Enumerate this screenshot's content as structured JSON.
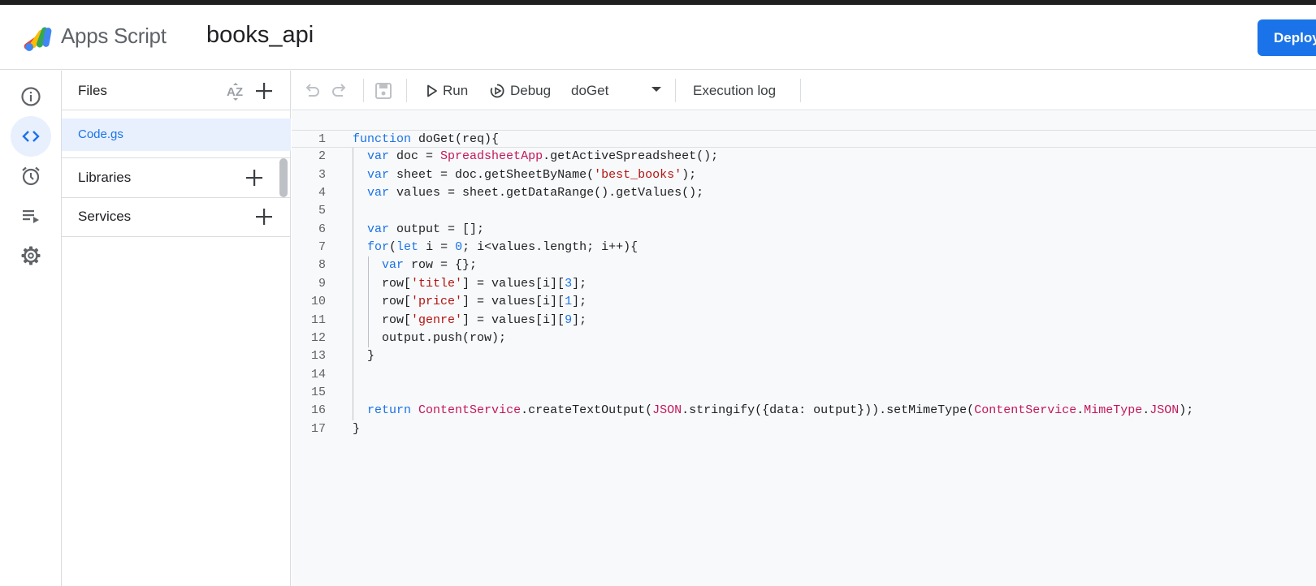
{
  "header": {
    "app_name": "Apps Script",
    "project_title": "books_api",
    "deploy_label": "Deploy"
  },
  "nav_rail": {
    "items": [
      {
        "name": "overview",
        "icon": "info-icon"
      },
      {
        "name": "editor",
        "icon": "code-icon",
        "active": true
      },
      {
        "name": "triggers",
        "icon": "alarm-icon"
      },
      {
        "name": "executions",
        "icon": "list-play-icon"
      },
      {
        "name": "settings",
        "icon": "gear-icon"
      }
    ]
  },
  "files_panel": {
    "files_label": "Files",
    "files": [
      "Code.gs"
    ],
    "libraries_label": "Libraries",
    "services_label": "Services"
  },
  "toolbar": {
    "run_label": "Run",
    "debug_label": "Debug",
    "function_selected": "doGet",
    "execution_log_label": "Execution log"
  },
  "editor": {
    "line_numbers": [
      "1",
      "2",
      "3",
      "4",
      "5",
      "6",
      "7",
      "8",
      "9",
      "10",
      "11",
      "12",
      "13",
      "14",
      "15",
      "16",
      "17"
    ],
    "lines": [
      {
        "tokens": [
          {
            "t": "function",
            "c": "kw"
          },
          {
            "t": " doGet(req){",
            "c": ""
          }
        ]
      },
      {
        "tokens": [
          {
            "t": "  ",
            "c": ""
          },
          {
            "t": "var",
            "c": "kw"
          },
          {
            "t": " doc = ",
            "c": ""
          },
          {
            "t": "SpreadsheetApp",
            "c": "cls"
          },
          {
            "t": ".getActiveSpreadsheet();",
            "c": ""
          }
        ]
      },
      {
        "tokens": [
          {
            "t": "  ",
            "c": ""
          },
          {
            "t": "var",
            "c": "kw"
          },
          {
            "t": " sheet = doc.getSheetByName(",
            "c": ""
          },
          {
            "t": "'best_books'",
            "c": "str"
          },
          {
            "t": ");",
            "c": ""
          }
        ]
      },
      {
        "tokens": [
          {
            "t": "  ",
            "c": ""
          },
          {
            "t": "var",
            "c": "kw"
          },
          {
            "t": " values = sheet.getDataRange().getValues();",
            "c": ""
          }
        ]
      },
      {
        "tokens": []
      },
      {
        "tokens": [
          {
            "t": "  ",
            "c": ""
          },
          {
            "t": "var",
            "c": "kw"
          },
          {
            "t": " output = [];",
            "c": ""
          }
        ]
      },
      {
        "tokens": [
          {
            "t": "  ",
            "c": ""
          },
          {
            "t": "for",
            "c": "kw"
          },
          {
            "t": "(",
            "c": ""
          },
          {
            "t": "let",
            "c": "kw"
          },
          {
            "t": " i = ",
            "c": ""
          },
          {
            "t": "0",
            "c": "num"
          },
          {
            "t": "; i<values.length; i++){",
            "c": ""
          }
        ]
      },
      {
        "tokens": [
          {
            "t": "    ",
            "c": ""
          },
          {
            "t": "var",
            "c": "kw"
          },
          {
            "t": " row = {};",
            "c": ""
          }
        ]
      },
      {
        "tokens": [
          {
            "t": "    row[",
            "c": ""
          },
          {
            "t": "'title'",
            "c": "str"
          },
          {
            "t": "] = values[i][",
            "c": ""
          },
          {
            "t": "3",
            "c": "num"
          },
          {
            "t": "];",
            "c": ""
          }
        ]
      },
      {
        "tokens": [
          {
            "t": "    row[",
            "c": ""
          },
          {
            "t": "'price'",
            "c": "str"
          },
          {
            "t": "] = values[i][",
            "c": ""
          },
          {
            "t": "1",
            "c": "num"
          },
          {
            "t": "];",
            "c": ""
          }
        ]
      },
      {
        "tokens": [
          {
            "t": "    row[",
            "c": ""
          },
          {
            "t": "'genre'",
            "c": "str"
          },
          {
            "t": "] = values[i][",
            "c": ""
          },
          {
            "t": "9",
            "c": "num"
          },
          {
            "t": "];",
            "c": ""
          }
        ]
      },
      {
        "tokens": [
          {
            "t": "    output.push(row);",
            "c": ""
          }
        ]
      },
      {
        "tokens": [
          {
            "t": "  }",
            "c": ""
          }
        ]
      },
      {
        "tokens": []
      },
      {
        "tokens": []
      },
      {
        "tokens": [
          {
            "t": "  ",
            "c": ""
          },
          {
            "t": "return",
            "c": "kw"
          },
          {
            "t": " ",
            "c": ""
          },
          {
            "t": "ContentService",
            "c": "cls"
          },
          {
            "t": ".createTextOutput(",
            "c": ""
          },
          {
            "t": "JSON",
            "c": "cls"
          },
          {
            "t": ".stringify({data: output})).setMimeType(",
            "c": ""
          },
          {
            "t": "ContentService",
            "c": "cls"
          },
          {
            "t": ".",
            "c": ""
          },
          {
            "t": "MimeType",
            "c": "cls"
          },
          {
            "t": ".",
            "c": ""
          },
          {
            "t": "JSON",
            "c": "cls"
          },
          {
            "t": ");",
            "c": ""
          }
        ]
      },
      {
        "tokens": [
          {
            "t": "}",
            "c": ""
          }
        ]
      }
    ]
  }
}
